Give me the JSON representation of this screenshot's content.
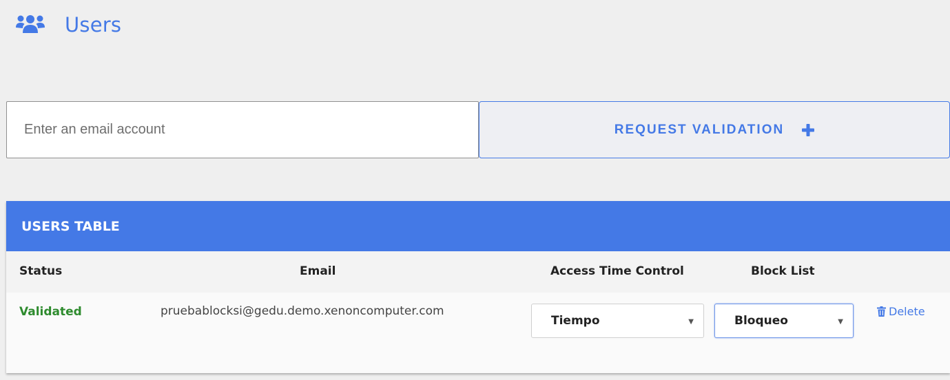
{
  "header": {
    "title": "Users",
    "icon": "users-icon"
  },
  "email_form": {
    "placeholder": "Enter an email account",
    "value": "",
    "request_button_label": "REQUEST VALIDATION",
    "request_button_icon": "plus-icon"
  },
  "table": {
    "title": "USERS TABLE",
    "columns": [
      "Status",
      "Email",
      "Access Time Control",
      "Block List"
    ],
    "rows": [
      {
        "status": "Validated",
        "email": "pruebablocksi@gedu.demo.xenoncomputer.com",
        "access_time_control": "Tiempo",
        "block_list": "Bloqueo",
        "delete_label": "Delete"
      }
    ]
  },
  "colors": {
    "accent": "#4479e6",
    "status_validated": "#2e8b2e",
    "background": "#efefef"
  }
}
